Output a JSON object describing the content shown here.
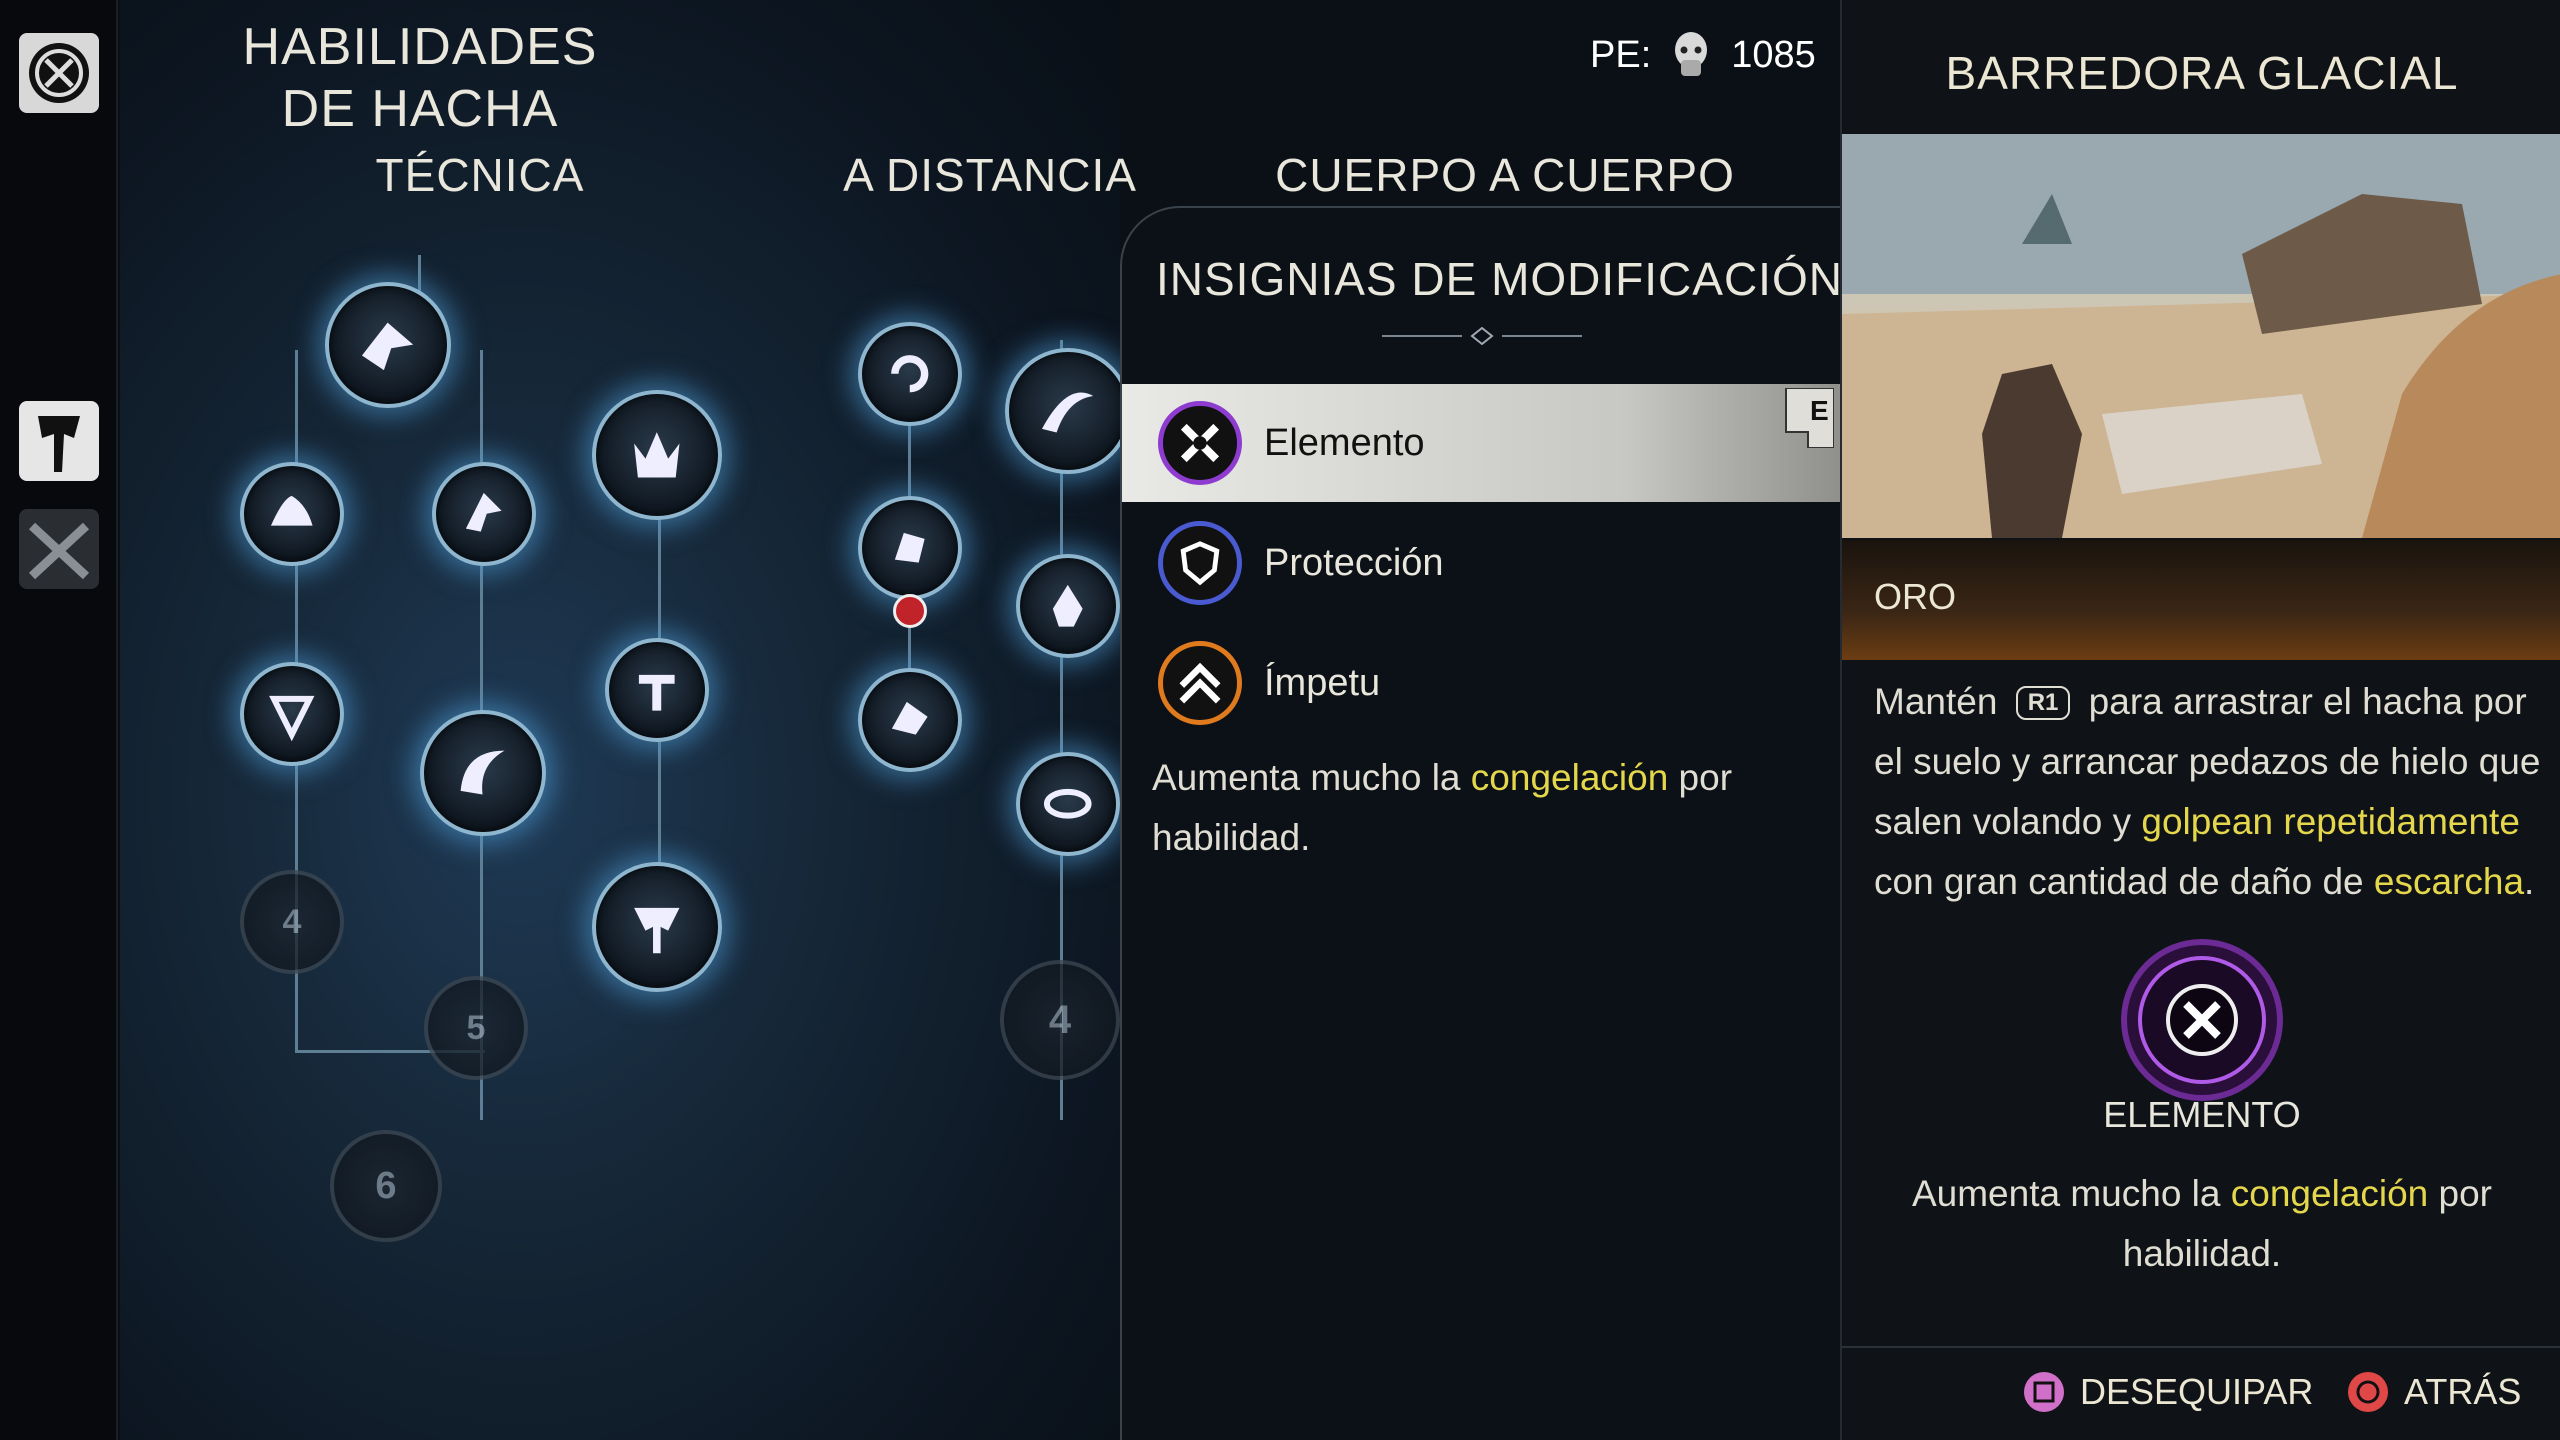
{
  "header": {
    "title": "HABILIDADES DE HACHA",
    "pe_label": "PE:",
    "pe_value": "1085"
  },
  "columns": [
    "TÉCNICA",
    "A DISTANCIA",
    "CUERPO A CUERPO"
  ],
  "locks": [
    "4",
    "5",
    "6",
    "4"
  ],
  "rail": {
    "icons": [
      "rune-emblem-icon",
      "axe-icon",
      "crossed-blades-icon"
    ]
  },
  "mods": {
    "title": "INSIGNIAS DE MODIFICACIÓN",
    "items": [
      {
        "label": "Elemento",
        "icon": "element-icon",
        "color": "#8e3bd0",
        "selected": true
      },
      {
        "label": "Protección",
        "icon": "shield-icon",
        "color": "#4a5ad0",
        "selected": false
      },
      {
        "label": "Ímpetu",
        "icon": "chevrons-up-icon",
        "color": "#e07a1f",
        "selected": false
      }
    ],
    "badge": "E",
    "desc_pre": "Aumenta mucho la ",
    "desc_hl": "congelación",
    "desc_post": " por habilidad."
  },
  "detail": {
    "title": "BARREDORA GLACIAL",
    "tier": "ORO",
    "desc": {
      "p1": "Mantén ",
      "button": "R1",
      "p2": " para arrastrar el hacha por el suelo y arrancar pedazos de hielo que salen volando y ",
      "hl1": "golpean repetidamente",
      "p3": " con gran cantidad de daño de  ",
      "hl2": "escarcha",
      "p4": "."
    },
    "element_label": "ELEMENTO",
    "element_desc_pre": "Aumenta mucho la ",
    "element_desc_hl": "congelación",
    "element_desc_post": " por habilidad."
  },
  "footer": {
    "unequip": "DESEQUIPAR",
    "back": "ATRÁS"
  },
  "colors": {
    "highlight": "#e5d74b",
    "element_purple": "#8e3bd0",
    "node_glow": "#5aa8e0"
  }
}
